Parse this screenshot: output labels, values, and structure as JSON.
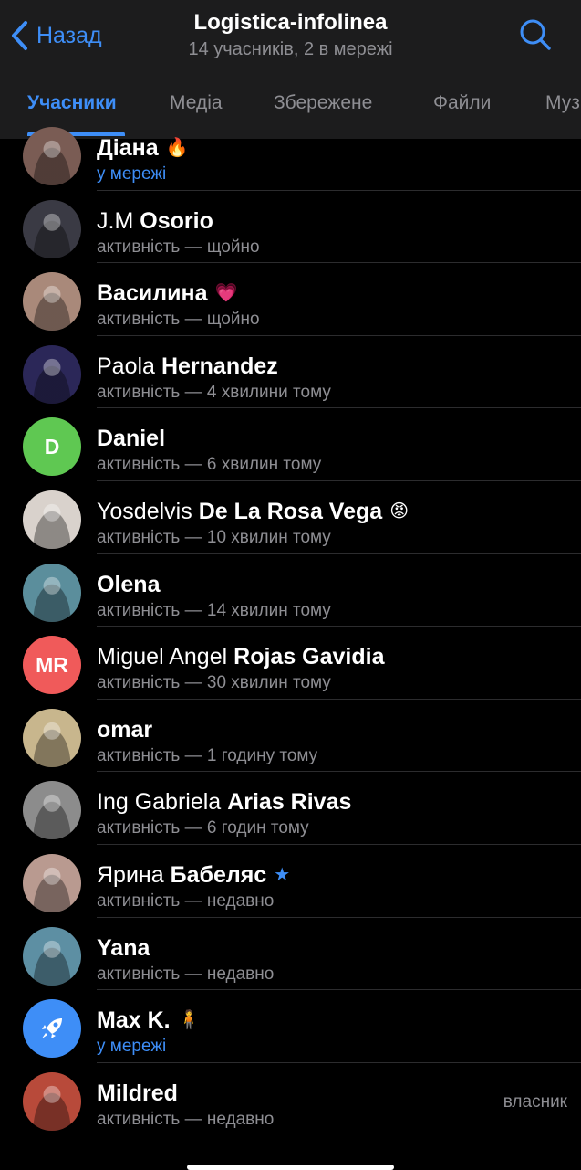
{
  "header": {
    "back_label": "Назад",
    "title": "Logistica-infolinea",
    "subtitle": "14 учасників, 2 в мережі"
  },
  "tabs": [
    {
      "label": "Учасники",
      "active": true
    },
    {
      "label": "Медіа",
      "active": false
    },
    {
      "label": "Збережене",
      "active": false
    },
    {
      "label": "Файли",
      "active": false
    },
    {
      "label": "Муз",
      "active": false
    }
  ],
  "colors": {
    "accent": "#3e8ef7",
    "header_bg": "#1c1c1d",
    "secondary_text": "#8e8e93"
  },
  "members": [
    {
      "first": "Діана",
      "last": "",
      "badge": "fire-emoji",
      "status": "у мережі",
      "online": true,
      "avatar": {
        "type": "photo",
        "icon": "photo-avatar",
        "color": "#7a5c54"
      },
      "role": ""
    },
    {
      "first": "J.M",
      "last": "Osorio",
      "badge": "",
      "status": "активність — щойно",
      "online": false,
      "avatar": {
        "type": "photo",
        "icon": "photo-avatar-eiffel",
        "color": "#3a3a44"
      },
      "role": ""
    },
    {
      "first": "Василина",
      "last": "",
      "badge": "pink-emoji",
      "status": "активність — щойно",
      "online": false,
      "avatar": {
        "type": "photo",
        "icon": "photo-avatar",
        "color": "#a9897a"
      },
      "role": ""
    },
    {
      "first": "Paola",
      "last": "Hernandez",
      "badge": "",
      "status": "активність — 4 хвилини тому",
      "online": false,
      "avatar": {
        "type": "photo",
        "icon": "photo-avatar",
        "color": "#2b2758"
      },
      "role": ""
    },
    {
      "first": "Daniel",
      "last": "",
      "badge": "",
      "status": "активність — 6 хвилин тому",
      "online": false,
      "avatar": {
        "type": "initials",
        "initials": "D",
        "color": "#5fc852"
      },
      "role": ""
    },
    {
      "first": "Yosdelvis",
      "last": "De La Rosa Vega",
      "badge": "angry-emoji",
      "status": "активність — 10 хвилин тому",
      "online": false,
      "avatar": {
        "type": "photo",
        "icon": "photo-avatar",
        "color": "#d9d2cc"
      },
      "role": ""
    },
    {
      "first": "Olena",
      "last": "",
      "badge": "",
      "status": "активність — 14 хвилин тому",
      "online": false,
      "avatar": {
        "type": "photo",
        "icon": "photo-avatar",
        "color": "#5b8e9c"
      },
      "role": ""
    },
    {
      "first": "Miguel Angel",
      "last": "Rojas Gavidia",
      "badge": "",
      "status": "активність — 30 хвилин тому",
      "online": false,
      "avatar": {
        "type": "initials",
        "initials": "MR",
        "color": "#f05a5a"
      },
      "role": ""
    },
    {
      "first": "omar",
      "last": "",
      "badge": "",
      "status": "активність — 1 годину тому",
      "online": false,
      "avatar": {
        "type": "photo",
        "icon": "photo-avatar",
        "color": "#c8b68d"
      },
      "role": ""
    },
    {
      "first": "Ing Gabriela",
      "last": "Arias Rivas",
      "badge": "",
      "status": "активність — 6 годин тому",
      "online": false,
      "avatar": {
        "type": "photo",
        "icon": "photo-avatar",
        "color": "#8c8c8c"
      },
      "role": ""
    },
    {
      "first": "Ярина",
      "last": "Бабеляс",
      "badge": "star-emoji",
      "status": "активність — недавно",
      "online": false,
      "avatar": {
        "type": "photo",
        "icon": "photo-avatar",
        "color": "#b99a90"
      },
      "role": ""
    },
    {
      "first": "Yana",
      "last": "",
      "badge": "",
      "status": "активність — недавно",
      "online": false,
      "avatar": {
        "type": "photo",
        "icon": "photo-avatar",
        "color": "#5d8fa3"
      },
      "role": ""
    },
    {
      "first": "Max K.",
      "last": "",
      "badge": "figure-emoji",
      "status": "у мережі",
      "online": true,
      "avatar": {
        "type": "icon",
        "icon": "rocket-icon",
        "color": "#3e8ef7"
      },
      "role": ""
    },
    {
      "first": "Mildred",
      "last": "",
      "badge": "",
      "status": "активність — недавно",
      "online": false,
      "avatar": {
        "type": "photo",
        "icon": "photo-avatar",
        "color": "#b84a3a"
      },
      "role": "власник"
    }
  ]
}
